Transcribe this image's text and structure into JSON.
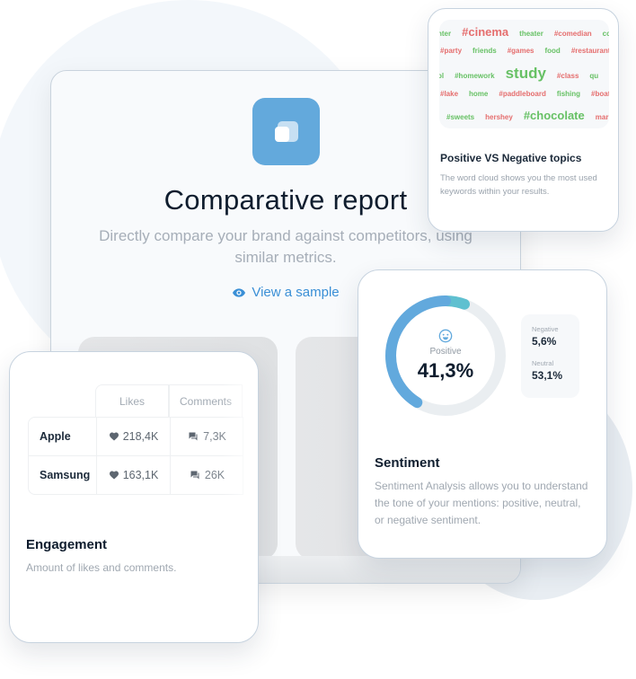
{
  "main": {
    "icon": "compare-squares-icon",
    "title": "Comparative report",
    "description": "Directly compare your brand against competitors, using similar metrics.",
    "view_sample": {
      "icon": "eye-icon",
      "label": "View a sample"
    }
  },
  "word_cloud": {
    "rows": [
      [
        {
          "t": "nter",
          "c": "green",
          "s": "s"
        },
        {
          "t": "#cinema",
          "c": "red",
          "s": "l"
        },
        {
          "t": "theater",
          "c": "green",
          "s": "s"
        },
        {
          "t": "#comedian",
          "c": "red",
          "s": "s"
        },
        {
          "t": "co",
          "c": "green",
          "s": "s"
        }
      ],
      [
        {
          "t": "#party",
          "c": "red",
          "s": "s"
        },
        {
          "t": "friends",
          "c": "green",
          "s": "s"
        },
        {
          "t": "#games",
          "c": "red",
          "s": "s"
        },
        {
          "t": "food",
          "c": "green",
          "s": "s"
        },
        {
          "t": "#restaurant",
          "c": "red",
          "s": "s"
        }
      ],
      [
        {
          "t": "ol",
          "c": "green",
          "s": "s"
        },
        {
          "t": "#homework",
          "c": "green",
          "s": "s"
        },
        {
          "t": "study",
          "c": "green",
          "s": "xl"
        },
        {
          "t": "#class",
          "c": "red",
          "s": "s"
        },
        {
          "t": "qu",
          "c": "green",
          "s": "s"
        }
      ],
      [
        {
          "t": "#lake",
          "c": "red",
          "s": "s"
        },
        {
          "t": "home",
          "c": "green",
          "s": "s"
        },
        {
          "t": "#paddleboard",
          "c": "red",
          "s": "s"
        },
        {
          "t": "fishing",
          "c": "green",
          "s": "s"
        },
        {
          "t": "#boat",
          "c": "red",
          "s": "s"
        }
      ],
      [
        {
          "t": "#sweets",
          "c": "green",
          "s": "s"
        },
        {
          "t": "hershey",
          "c": "red",
          "s": "s"
        },
        {
          "t": "#chocolate",
          "c": "green",
          "s": "l"
        },
        {
          "t": "mar",
          "c": "red",
          "s": "s"
        }
      ]
    ],
    "title": "Positive VS Negative topics",
    "description": "The word cloud shows you the most used keywords within your results."
  },
  "sentiment": {
    "positive_label": "Positive",
    "positive_value": "41,3%",
    "positive_pct": 41.3,
    "negative_label": "Negative",
    "negative_value": "5,6%",
    "negative_pct": 5.6,
    "neutral_label": "Neutral",
    "neutral_value": "53,1%",
    "neutral_pct": 53.1,
    "icon": "smile-icon",
    "colors": {
      "positive": "#62a9dd",
      "negative": "#5fc0d0",
      "neutral": "#eaeef1"
    },
    "title": "Sentiment",
    "description": "Sentiment Analysis allows you to understand the tone of your mentions: positive, neutral, or negative sentiment."
  },
  "engagement": {
    "columns": [
      "Likes",
      "Comments"
    ],
    "rows": [
      {
        "brand": "Apple",
        "likes": "218,4K",
        "comments": "7,3K"
      },
      {
        "brand": "Samsung",
        "likes": "163,1K",
        "comments": "26K"
      }
    ],
    "title": "Engagement",
    "description": "Amount of likes and comments."
  }
}
